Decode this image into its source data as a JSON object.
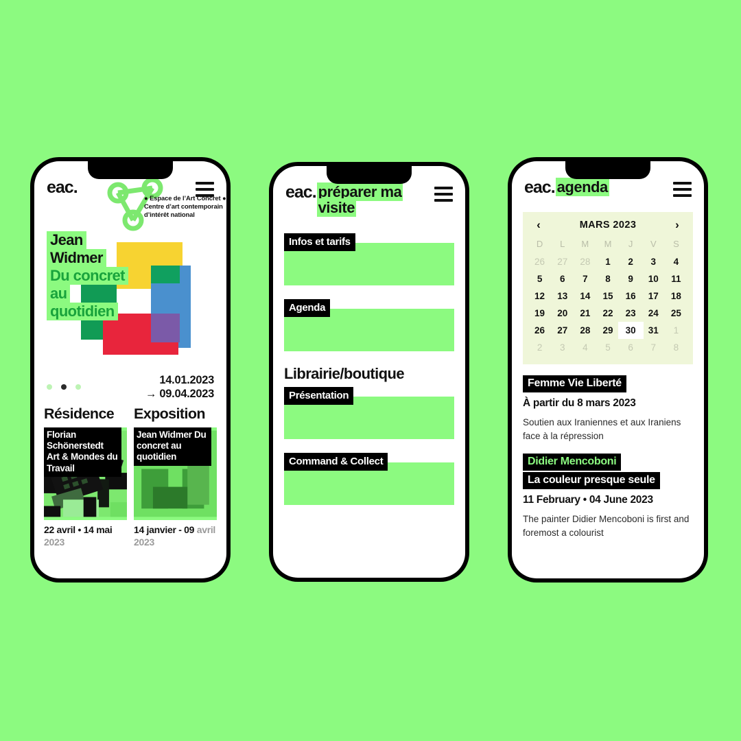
{
  "background_color": "#8CFA80",
  "accent_green": "#8CFA80",
  "brand": "eac.",
  "phone1": {
    "name": "home-screen",
    "logo_icon": "eac-triangle-logo",
    "menu_icon": "hamburger-menu-icon",
    "tagline_line1": "● Espace de l’Art Concret ●",
    "tagline_line2": "Centre d’art contemporain",
    "tagline_line3": "d’intérêt national",
    "hero": {
      "line1": "Jean",
      "line2": "Widmer",
      "line3": "Du concret",
      "line4": "au",
      "line5": "quotidien",
      "date_start": "14.01.2023",
      "date_end": "09.04.2023",
      "arrow": "→",
      "dots_total": 3,
      "dot_active_index": 1
    },
    "sections": [
      {
        "heading": "Résidence"
      },
      {
        "heading": "Exposition"
      }
    ],
    "cards": [
      {
        "label": "Florian Schönerstedt Art & Mondes du Travail",
        "date": "22 avril • 14 mai",
        "year": "2023",
        "image": "duotone-hand-calculator-photo"
      },
      {
        "label": "Jean Widmer Du concret au quotidien",
        "date": "14 janvier - 09",
        "year": "avril 2023",
        "image": "abstract-green-rectangles"
      }
    ]
  },
  "phone2": {
    "name": "prepare-my-visit-screen",
    "title": "préparer ma visite",
    "menu_icon": "hamburger-menu-icon",
    "items": [
      {
        "label": "Infos et tarifs"
      },
      {
        "label": "Agenda"
      }
    ],
    "section_heading": "Librairie/boutique",
    "section_items": [
      {
        "label": "Présentation"
      },
      {
        "label": "Command & Collect"
      }
    ]
  },
  "phone3": {
    "name": "agenda-screen",
    "title": "agenda",
    "menu_icon": "hamburger-menu-icon",
    "calendar": {
      "prev_icon": "chevron-left-icon",
      "next_icon": "chevron-right-icon",
      "month_label": "MARS 2023",
      "weekdays": [
        "D",
        "L",
        "M",
        "M",
        "J",
        "V",
        "S"
      ],
      "selected_day": "30",
      "weeks": [
        [
          {
            "n": "26",
            "mute": true
          },
          {
            "n": "27",
            "mute": true
          },
          {
            "n": "28",
            "mute": true
          },
          {
            "n": "1"
          },
          {
            "n": "2"
          },
          {
            "n": "3"
          },
          {
            "n": "4"
          }
        ],
        [
          {
            "n": "5"
          },
          {
            "n": "6"
          },
          {
            "n": "7"
          },
          {
            "n": "8"
          },
          {
            "n": "9"
          },
          {
            "n": "10"
          },
          {
            "n": "11"
          }
        ],
        [
          {
            "n": "12"
          },
          {
            "n": "13"
          },
          {
            "n": "14"
          },
          {
            "n": "15"
          },
          {
            "n": "16"
          },
          {
            "n": "17"
          },
          {
            "n": "18"
          }
        ],
        [
          {
            "n": "19"
          },
          {
            "n": "20"
          },
          {
            "n": "21"
          },
          {
            "n": "22"
          },
          {
            "n": "23"
          },
          {
            "n": "24"
          },
          {
            "n": "25"
          }
        ],
        [
          {
            "n": "26"
          },
          {
            "n": "27"
          },
          {
            "n": "28"
          },
          {
            "n": "29"
          },
          {
            "n": "30",
            "sel": true
          },
          {
            "n": "31"
          },
          {
            "n": "1",
            "mute": true
          }
        ],
        [
          {
            "n": "2",
            "mute": true
          },
          {
            "n": "3",
            "mute": true
          },
          {
            "n": "4",
            "mute": true
          },
          {
            "n": "5",
            "mute": true
          },
          {
            "n": "6",
            "mute": true
          },
          {
            "n": "7",
            "mute": true
          },
          {
            "n": "8",
            "mute": true
          }
        ]
      ]
    },
    "events": [
      {
        "title": "Femme Vie Liberté",
        "date": "À partir du 8 mars 2023",
        "description": "Soutien aux Iraniennes et aux Iraniens face à la répression"
      },
      {
        "title_green": "Didier Mencoboni",
        "title_white": "La couleur presque seule",
        "date": "11 February • 04 June 2023",
        "description": "The painter Didier Mencoboni is first and foremost a colourist"
      }
    ]
  }
}
